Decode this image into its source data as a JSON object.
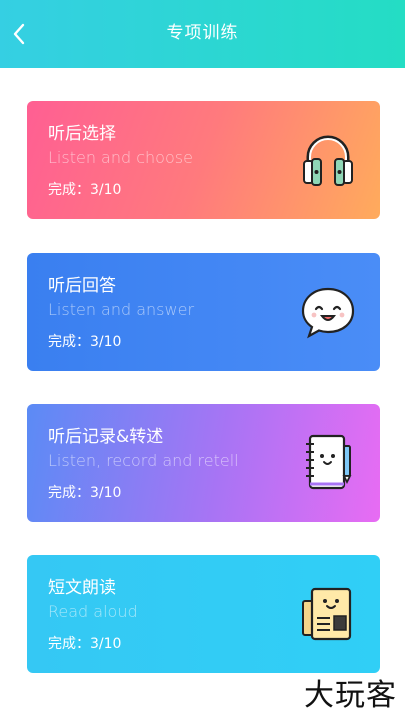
{
  "header": {
    "title": "专项训练",
    "back_icon": "chevron-left-icon"
  },
  "cards": [
    {
      "title": "听后选择",
      "subtitle": "Listen and choose",
      "progress": "完成：3/10",
      "icon": "headphones-icon"
    },
    {
      "title": "听后回答",
      "subtitle": "Listen and answer",
      "progress": "完成：3/10",
      "icon": "speech-bubble-face-icon"
    },
    {
      "title": "听后记录&转述",
      "subtitle": "Listen, record and retell",
      "progress": "完成：3/10",
      "icon": "notebook-icon"
    },
    {
      "title": "短文朗读",
      "subtitle": "Read aloud",
      "progress": "完成：3/10",
      "icon": "newspaper-icon"
    }
  ],
  "watermark": "大玩客",
  "colors": {
    "header_start": "#35cfe3",
    "header_end": "#24ddc4",
    "card1_start": "#ff5f93",
    "card1_end": "#ffab5c",
    "card2": "#3a7ff0",
    "card3_start": "#5b8bf5",
    "card3_end": "#e86cf3",
    "card4": "#35c8f4"
  }
}
